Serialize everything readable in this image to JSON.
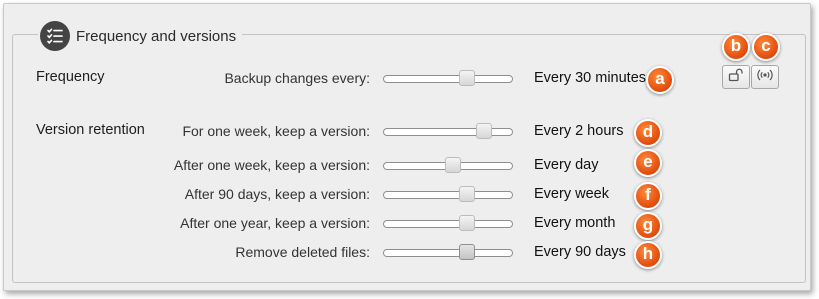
{
  "group": {
    "title": "Frequency and versions",
    "icon": "checklist-icon"
  },
  "frequency": {
    "section_label": "Frequency",
    "row": {
      "label": "Backup changes every:",
      "value": "Every 30 minutes",
      "slider_fraction": 0.67,
      "marker": "a"
    }
  },
  "retention": {
    "section_label": "Version retention",
    "rows": [
      {
        "label": "For one week, keep a version:",
        "value": "Every 2 hours",
        "slider_fraction": 0.82,
        "marker": "d"
      },
      {
        "label": "After one week, keep a version:",
        "value": "Every day",
        "slider_fraction": 0.54,
        "marker": "e"
      },
      {
        "label": "After 90 days, keep a version:",
        "value": "Every week",
        "slider_fraction": 0.67,
        "marker": "f"
      },
      {
        "label": "After one year, keep a version:",
        "value": "Every month",
        "slider_fraction": 0.67,
        "marker": "g"
      },
      {
        "label": "Remove deleted files:",
        "value": "Every 90 days",
        "slider_fraction": 0.67,
        "marker": "h"
      }
    ]
  },
  "toolbar": {
    "lock_button": {
      "icon": "unlock-icon",
      "marker": "b"
    },
    "broadcast_button": {
      "icon": "broadcast-icon",
      "marker": "c"
    }
  },
  "colors": {
    "marker": "#e8561a",
    "panel_bg": "#eeeeee",
    "legend_icon_bg": "#444444"
  }
}
